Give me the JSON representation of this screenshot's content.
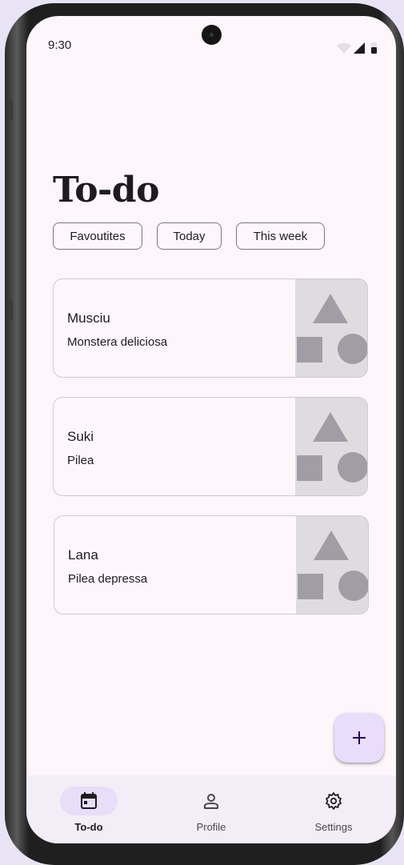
{
  "status_bar": {
    "time": "9:30"
  },
  "page": {
    "title": "To-do"
  },
  "chips": [
    "Favoutites",
    "Today",
    "This week"
  ],
  "plants": [
    {
      "name": "Musciu",
      "species": "Monstera deliciosa"
    },
    {
      "name": "Suki",
      "species": "Pilea"
    },
    {
      "name": "Lana",
      "species": "Pilea depressa"
    }
  ],
  "fab": {
    "icon": "plus-icon"
  },
  "nav": {
    "items": [
      {
        "label": "To-do",
        "icon": "calendar-icon",
        "active": true
      },
      {
        "label": "Profile",
        "icon": "person-icon",
        "active": false
      },
      {
        "label": "Settings",
        "icon": "gear-icon",
        "active": false
      }
    ]
  },
  "colors": {
    "screen_bg": "#fdf7fc",
    "fab_bg": "#eadcfb",
    "nav_bg": "#f3edf7",
    "nav_active_pill": "#e8def8",
    "placeholder_shape": "#a09ea4",
    "placeholder_bg": "#dedcde"
  }
}
